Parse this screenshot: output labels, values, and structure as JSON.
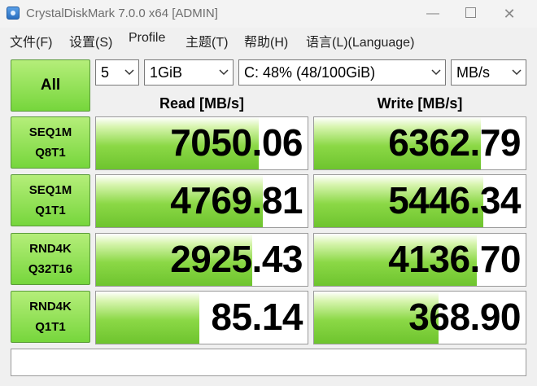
{
  "window": {
    "title": "CrystalDiskMark 7.0.0 x64 [ADMIN]"
  },
  "menu": [
    "文件(F)",
    "设置(S)",
    "Profile",
    "主题(T)",
    "帮助(H)",
    "语言(L)(Language)"
  ],
  "controls": {
    "all_label": "All",
    "test_count": "5",
    "test_size": "1GiB",
    "drive": "C: 48% (48/100GiB)",
    "unit": "MB/s"
  },
  "headers": {
    "read": "Read [MB/s]",
    "write": "Write [MB/s]"
  },
  "tests": [
    {
      "line1": "SEQ1M",
      "line2": "Q8T1",
      "read": "7050.06",
      "write": "6362.79",
      "read_fill": 0.77,
      "write_fill": 0.79
    },
    {
      "line1": "SEQ1M",
      "line2": "Q1T1",
      "read": "4769.81",
      "write": "5446.34",
      "read_fill": 0.79,
      "write_fill": 0.8
    },
    {
      "line1": "RND4K",
      "line2": "Q32T16",
      "read": "2925.43",
      "write": "4136.70",
      "read_fill": 0.74,
      "write_fill": 0.77
    },
    {
      "line1": "RND4K",
      "line2": "Q1T1",
      "read": "85.14",
      "write": "368.90",
      "read_fill": 0.49,
      "write_fill": 0.59
    }
  ],
  "comment": ""
}
